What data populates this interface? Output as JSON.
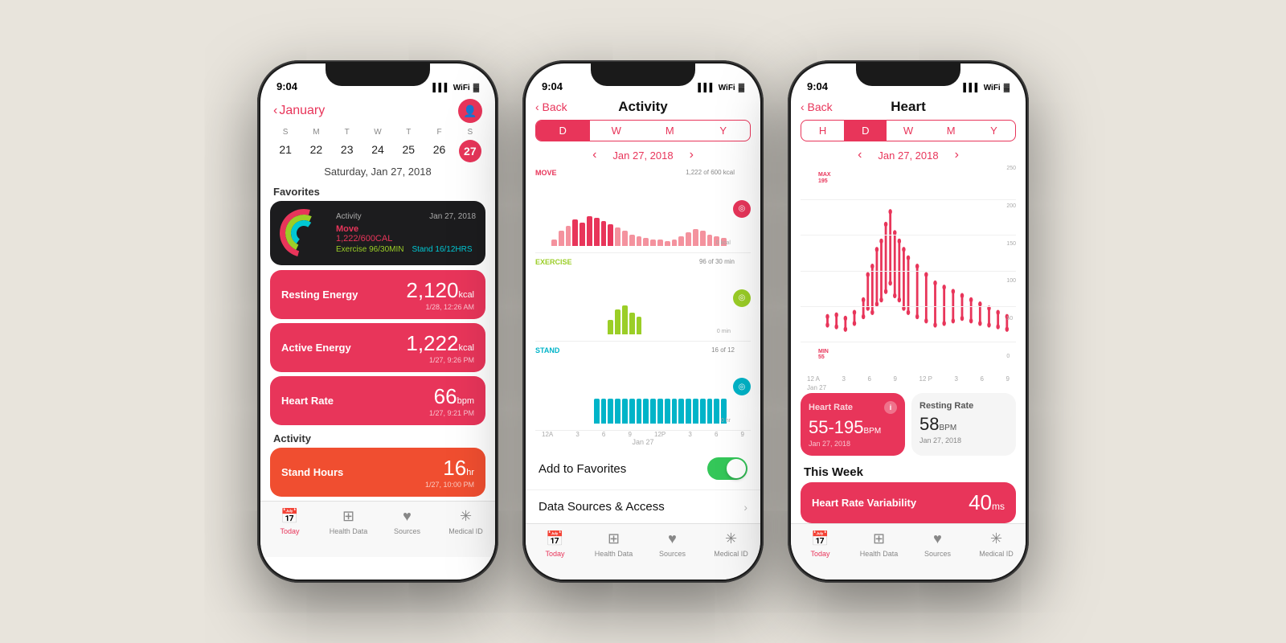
{
  "background": "#e8e4dc",
  "phones": [
    {
      "id": "phone1",
      "status": {
        "time": "9:04",
        "signal": "▌▌▌",
        "wifi": "WiFi",
        "battery": "Battery"
      },
      "nav": {
        "back_arrow": "‹",
        "title": "January",
        "avatar_icon": "person"
      },
      "calendar": {
        "days": [
          "S",
          "M",
          "T",
          "W",
          "T",
          "F",
          "S"
        ],
        "dates": [
          "21",
          "22",
          "23",
          "24",
          "25",
          "26",
          "27"
        ],
        "selected": "27",
        "date_label": "Saturday, Jan 27, 2018"
      },
      "favorites_label": "Favorites",
      "activity_card": {
        "title": "Activity",
        "date": "Jan 27, 2018",
        "move": "Move",
        "move_value": "1,222/600CAL",
        "exercise": "Exercise",
        "exercise_value": "96/30MIN",
        "stand": "Stand",
        "stand_value": "16/12HRS"
      },
      "metrics": [
        {
          "label": "Resting Energy",
          "value": "2,120",
          "unit": "kcal",
          "sub": "1/28, 12:26 AM",
          "color": "#e8355a"
        },
        {
          "label": "Active Energy",
          "value": "1,222",
          "unit": "kcal",
          "sub": "1/27, 9:26 PM",
          "color": "#e8355a"
        },
        {
          "label": "Heart Rate",
          "value": "66",
          "unit": "bpm",
          "sub": "1/27, 9:21 PM",
          "color": "#e8355a"
        }
      ],
      "activity_label": "Activity",
      "stand_hours": {
        "label": "Stand Hours",
        "value": "16",
        "unit": "hr",
        "sub": "1/27, 10:00 PM",
        "color": "#f04e30"
      },
      "tabs": [
        {
          "label": "Today",
          "icon": "📅",
          "active": true
        },
        {
          "label": "Health Data",
          "icon": "⊞",
          "active": false
        },
        {
          "label": "Sources",
          "icon": "♥",
          "active": false
        },
        {
          "label": "Medical ID",
          "icon": "✳",
          "active": false
        }
      ]
    },
    {
      "id": "phone2",
      "status": {
        "time": "9:04"
      },
      "nav": {
        "back": "‹ Back",
        "title": "Activity"
      },
      "segments": [
        "D",
        "W",
        "M",
        "Y"
      ],
      "active_segment": "D",
      "date_nav": {
        "left": "‹",
        "date": "Jan 27, 2018",
        "right": "›"
      },
      "charts": [
        {
          "label": "MOVE",
          "color": "#e8355a",
          "meta": "1,222 of 600 kcal",
          "axis_label": "0 kcal",
          "icon_color": "#e8355a",
          "bars": [
            20,
            45,
            60,
            80,
            70,
            90,
            85,
            75,
            65,
            55,
            45,
            35,
            30,
            25,
            20,
            18,
            15,
            20,
            30,
            40,
            50,
            45,
            35,
            30,
            25
          ]
        },
        {
          "label": "EXERCISE",
          "color": "#9bce27",
          "meta": "96 of 30 min",
          "axis_label": "0 min",
          "icon_color": "#9bce27",
          "bars": [
            0,
            0,
            0,
            0,
            0,
            0,
            0,
            0,
            40,
            70,
            80,
            60,
            50,
            0,
            0,
            0,
            0,
            0,
            0,
            0,
            0,
            0,
            0,
            0,
            0
          ]
        },
        {
          "label": "STAND",
          "color": "#00b4c8",
          "meta": "16 of 12",
          "axis_label": "0 hr",
          "icon_color": "#00b4c8",
          "bars": [
            0,
            0,
            0,
            0,
            0,
            0,
            70,
            70,
            70,
            70,
            70,
            70,
            70,
            70,
            70,
            70,
            70,
            70,
            70,
            70,
            70,
            70,
            70,
            70,
            70
          ]
        }
      ],
      "time_labels": [
        "12A",
        "3",
        "6",
        "9",
        "12P",
        "3",
        "6",
        "9"
      ],
      "date_label": "Jan 27",
      "toggle": {
        "label": "Add to Favorites",
        "state": true
      },
      "datasource": {
        "label": "Data Sources & Access",
        "arrow": "›"
      },
      "tabs": [
        {
          "label": "Today",
          "icon": "📅",
          "active": true
        },
        {
          "label": "Health Data",
          "icon": "⊞",
          "active": false
        },
        {
          "label": "Sources",
          "icon": "♥",
          "active": false
        },
        {
          "label": "Medical ID",
          "icon": "✳",
          "active": false
        }
      ]
    },
    {
      "id": "phone3",
      "status": {
        "time": "9:04"
      },
      "nav": {
        "back": "‹ Back",
        "title": "Heart"
      },
      "segments": [
        "H",
        "D",
        "W",
        "M",
        "Y"
      ],
      "active_segment": "D",
      "date_nav": {
        "left": "‹",
        "date": "Jan 27, 2018",
        "right": "›"
      },
      "chart": {
        "max_label": "MAX\n195",
        "min_label": "MIN\n55",
        "y_labels": [
          "250",
          "200",
          "150",
          "100",
          "50",
          "0"
        ]
      },
      "cards": [
        {
          "type": "primary",
          "title": "Heart Rate",
          "value": "55-195",
          "unit": "BPM",
          "date": "Jan 27, 2018"
        },
        {
          "type": "secondary",
          "title": "Resting Rate",
          "value": "58",
          "unit": "BPM",
          "date": "Jan 27, 2018"
        }
      ],
      "this_week_label": "This Week",
      "hrv": {
        "label": "Heart Rate Variability",
        "value": "40",
        "unit": "ms"
      },
      "tabs": [
        {
          "label": "Today",
          "icon": "📅",
          "active": true
        },
        {
          "label": "Health Data",
          "icon": "⊞",
          "active": false
        },
        {
          "label": "Sources",
          "icon": "♥",
          "active": false
        },
        {
          "label": "Medical ID",
          "icon": "✳",
          "active": false
        }
      ]
    }
  ]
}
